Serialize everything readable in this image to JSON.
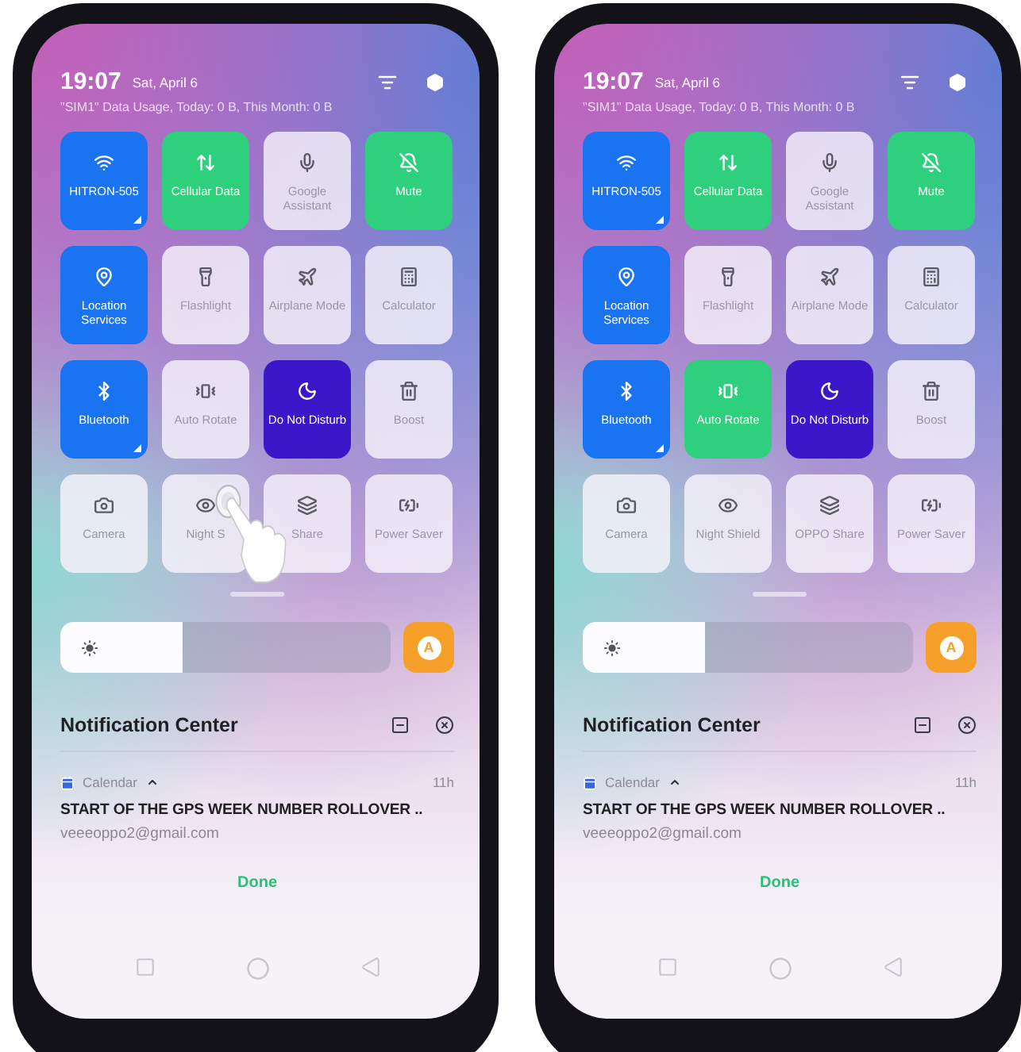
{
  "phones": [
    {
      "time": "19:07",
      "date": "Sat, April 6",
      "data_usage": "\"SIM1\" Data Usage, Today: 0 B, This Month: 0 B",
      "tiles": [
        {
          "label": "HITRON-505",
          "on": true,
          "color": "#1a73f0",
          "expandable": true
        },
        {
          "label": "Cellular Data",
          "on": true,
          "color": "#2ecf7d",
          "expandable": false
        },
        {
          "label": "Google Assistant",
          "on": false,
          "expandable": false
        },
        {
          "label": "Mute",
          "on": true,
          "color": "#2ecf7d",
          "expandable": false
        },
        {
          "label": "Location Services",
          "on": true,
          "color": "#1a73f0",
          "expandable": false
        },
        {
          "label": "Flashlight",
          "on": false,
          "expandable": false
        },
        {
          "label": "Airplane Mode",
          "on": false,
          "expandable": false
        },
        {
          "label": "Calculator",
          "on": false,
          "expandable": false
        },
        {
          "label": "Bluetooth",
          "on": true,
          "color": "#1a73f0",
          "expandable": true
        },
        {
          "label": "Auto Rotate",
          "on": false,
          "expandable": false
        },
        {
          "label": "Do Not Disturb",
          "on": true,
          "color": "#3a18c9",
          "expandable": false
        },
        {
          "label": "Boost",
          "on": false,
          "expandable": false
        },
        {
          "label": "Camera",
          "on": false,
          "expandable": false
        },
        {
          "label": "Night S",
          "on": false,
          "expandable": false
        },
        {
          "label": "Share",
          "on": false,
          "expandable": false
        },
        {
          "label": "Power Saver",
          "on": false,
          "expandable": false
        }
      ],
      "brightness": {
        "level": 0.37
      },
      "auto_label": "A",
      "notification_center": {
        "title": "Notification Center"
      },
      "notification": {
        "app": "Calendar",
        "time": "11h",
        "title": "START OF THE GPS WEEK NUMBER ROLLOVER ..",
        "account": "veeeoppo2@gmail.com"
      },
      "done": "Done",
      "touch_indicator": true
    },
    {
      "time": "19:07",
      "date": "Sat, April 6",
      "data_usage": "\"SIM1\" Data Usage, Today: 0 B, This Month: 0 B",
      "tiles": [
        {
          "label": "HITRON-505",
          "on": true,
          "color": "#1a73f0",
          "expandable": true
        },
        {
          "label": "Cellular Data",
          "on": true,
          "color": "#2ecf7d",
          "expandable": false
        },
        {
          "label": "Google Assistant",
          "on": false,
          "expandable": false
        },
        {
          "label": "Mute",
          "on": true,
          "color": "#2ecf7d",
          "expandable": false
        },
        {
          "label": "Location Services",
          "on": true,
          "color": "#1a73f0",
          "expandable": false
        },
        {
          "label": "Flashlight",
          "on": false,
          "expandable": false
        },
        {
          "label": "Airplane Mode",
          "on": false,
          "expandable": false
        },
        {
          "label": "Calculator",
          "on": false,
          "expandable": false
        },
        {
          "label": "Bluetooth",
          "on": true,
          "color": "#1a73f0",
          "expandable": true
        },
        {
          "label": "Auto Rotate",
          "on": true,
          "color": "#2ecf7d",
          "expandable": false
        },
        {
          "label": "Do Not Disturb",
          "on": true,
          "color": "#3a18c9",
          "expandable": false
        },
        {
          "label": "Boost",
          "on": false,
          "expandable": false
        },
        {
          "label": "Camera",
          "on": false,
          "expandable": false
        },
        {
          "label": "Night Shield",
          "on": false,
          "expandable": false
        },
        {
          "label": "OPPO Share",
          "on": false,
          "expandable": false
        },
        {
          "label": "Power Saver",
          "on": false,
          "expandable": false
        }
      ],
      "brightness": {
        "level": 0.37
      },
      "auto_label": "A",
      "notification_center": {
        "title": "Notification Center"
      },
      "notification": {
        "app": "Calendar",
        "time": "11h",
        "title": "START OF THE GPS WEEK NUMBER ROLLOVER ..",
        "account": "veeeoppo2@gmail.com"
      },
      "done": "Done",
      "touch_indicator": false
    }
  ]
}
